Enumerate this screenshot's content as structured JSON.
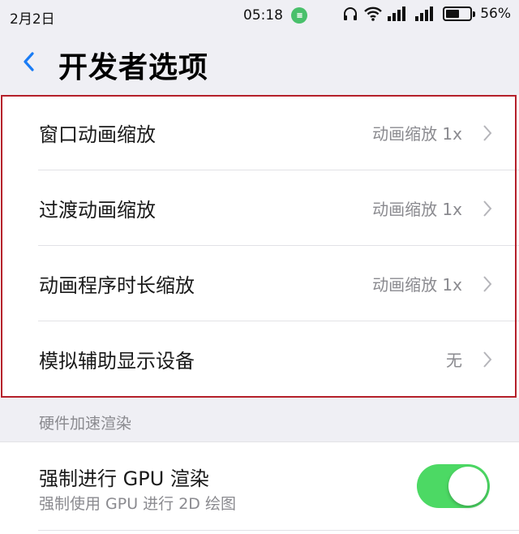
{
  "status_bar": {
    "date": "2月2日",
    "time": "05:18",
    "battery_percent": "56%",
    "battery_level": 0.56
  },
  "header": {
    "title": "开发者选项"
  },
  "animation_settings": [
    {
      "label": "窗口动画缩放",
      "value": "动画缩放 1x"
    },
    {
      "label": "过渡动画缩放",
      "value": "动画缩放 1x"
    },
    {
      "label": "动画程序时长缩放",
      "value": "动画缩放 1x"
    },
    {
      "label": "模拟辅助显示设备",
      "value": "无"
    }
  ],
  "hardware_section": {
    "header": "硬件加速渲染",
    "gpu_title": "强制进行 GPU 渲染",
    "gpu_subtitle": "强制使用 GPU 进行 2D 绘图",
    "gpu_enabled": true
  },
  "colors": {
    "accent": "#1a7cf5",
    "toggle_on": "#4cd964",
    "highlight_border": "#b5202a"
  }
}
